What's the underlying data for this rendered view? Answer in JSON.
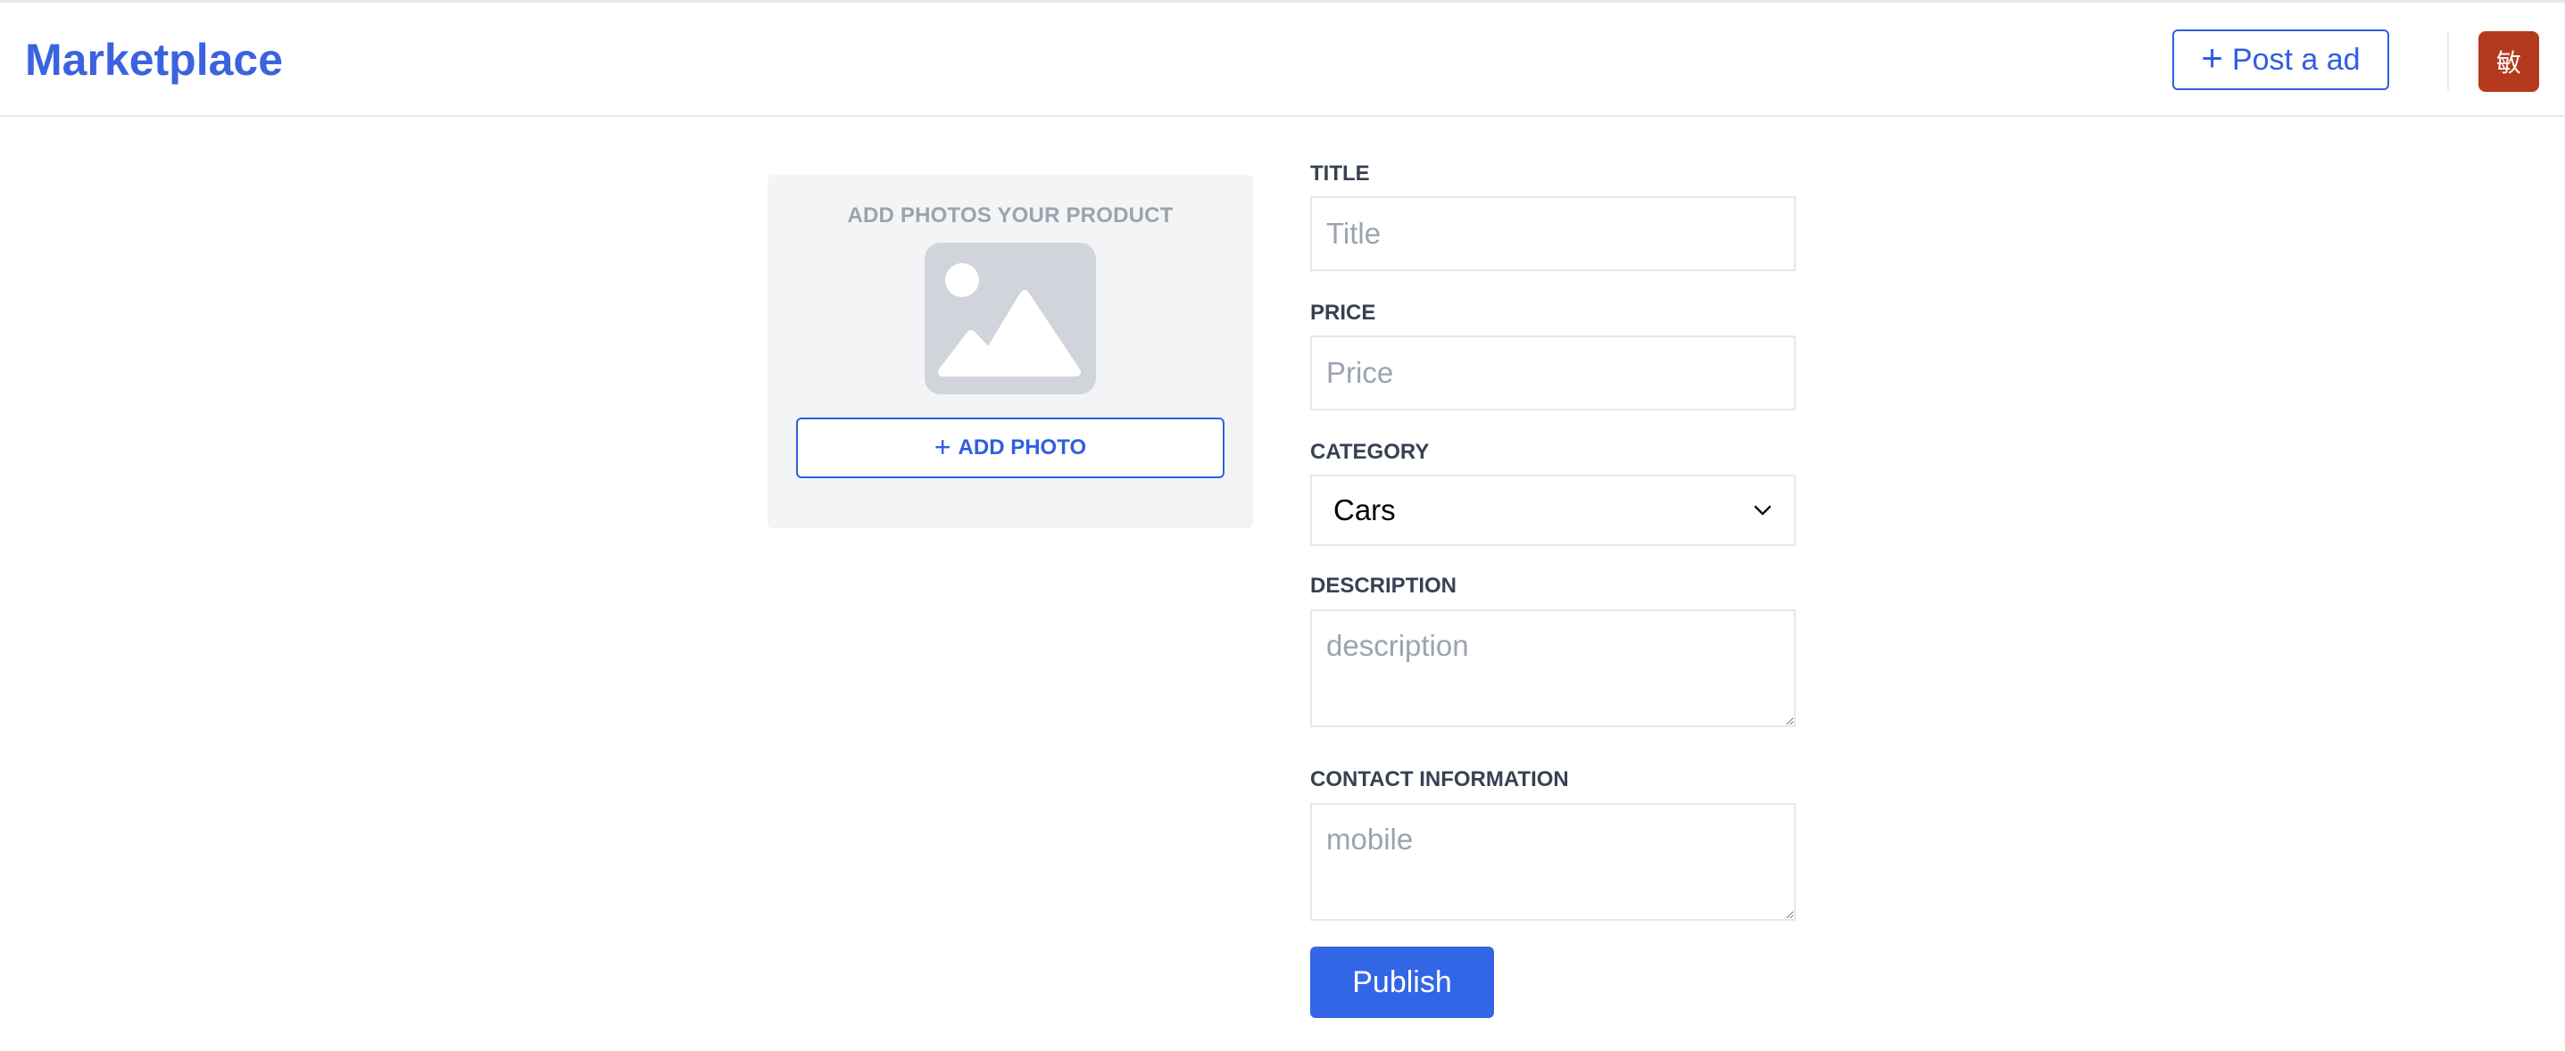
{
  "header": {
    "brand": "Marketplace",
    "post_button": {
      "icon": "plus-icon",
      "label": "Post a ad"
    },
    "avatar_text": "敏",
    "avatar_color": "#b5391c"
  },
  "photo_panel": {
    "title": "ADD PHOTOS YOUR PRODUCT",
    "placeholder_icon": "image-placeholder-icon",
    "add_button": {
      "icon": "plus-icon",
      "label": "ADD PHOTO"
    }
  },
  "form": {
    "title": {
      "label": "TITLE",
      "placeholder": "Title",
      "value": ""
    },
    "price": {
      "label": "PRICE",
      "placeholder": "Price",
      "value": ""
    },
    "category": {
      "label": "CATEGORY",
      "selected": "Cars",
      "icon": "chevron-down-icon"
    },
    "description": {
      "label": "DESCRIPTION",
      "placeholder": "description",
      "value": ""
    },
    "contact": {
      "label": "CONTACT INFORMATION",
      "placeholder": "mobile",
      "value": ""
    },
    "publish_label": "Publish"
  },
  "colors": {
    "accent": "#3366e6",
    "brand": "#3b63e0"
  }
}
